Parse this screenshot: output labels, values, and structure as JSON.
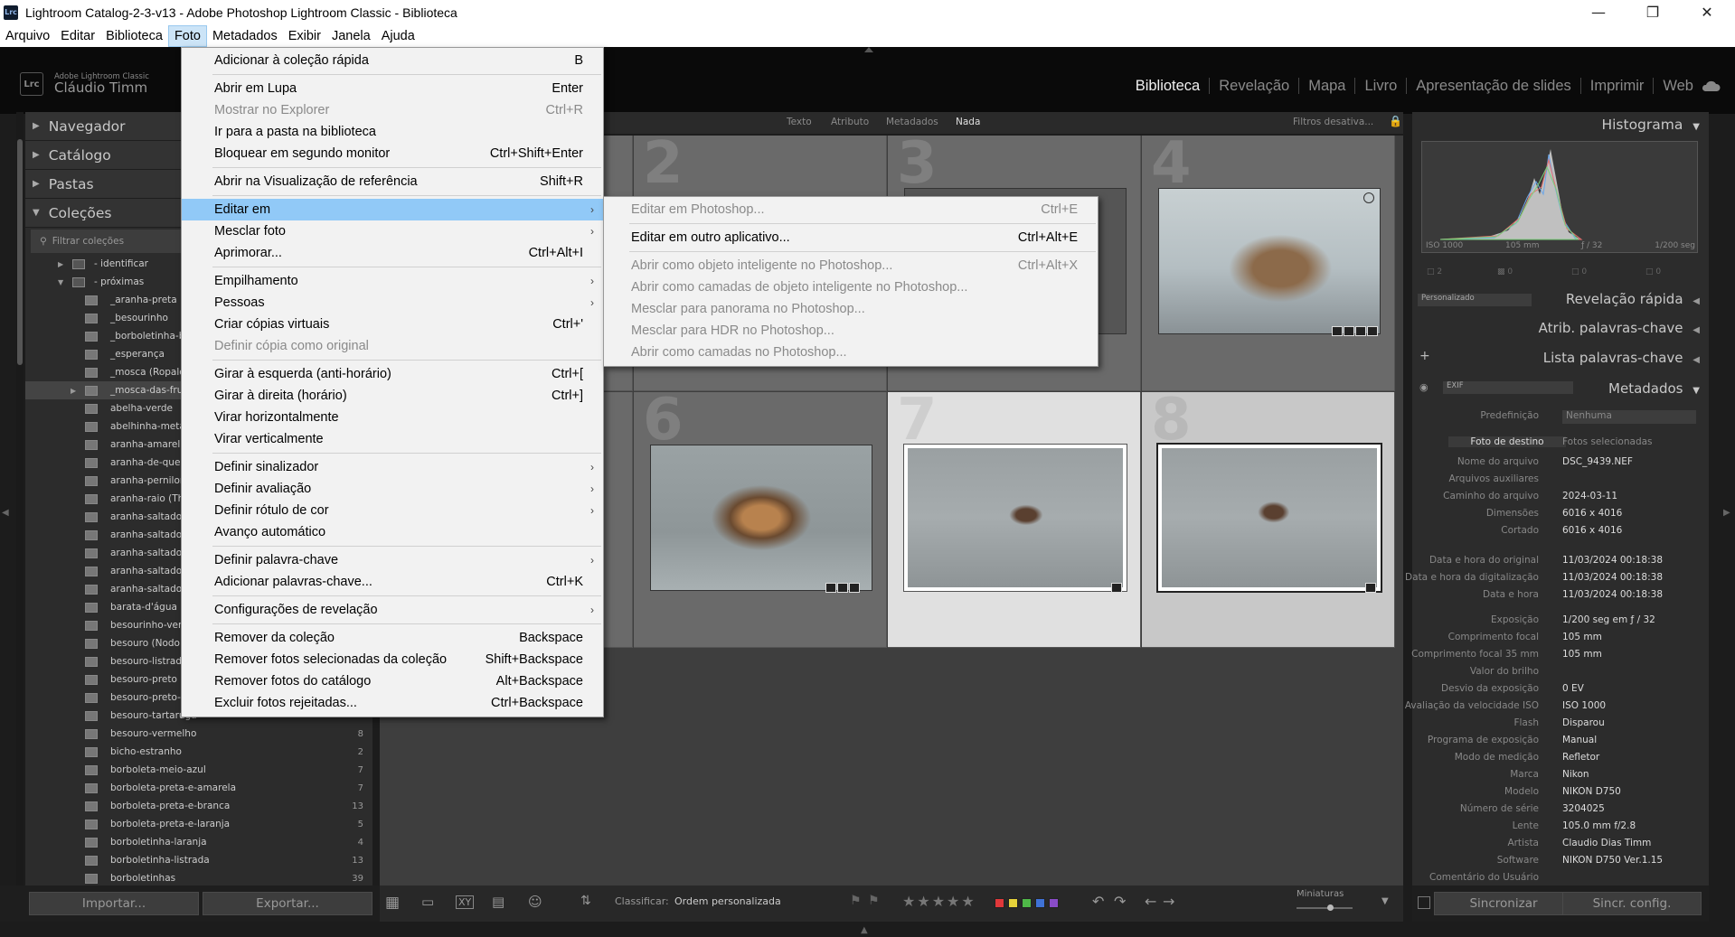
{
  "window": {
    "badge": "Lrc",
    "title": "Lightroom Catalog-2-3-v13 - Adobe Photoshop Lightroom Classic - Biblioteca"
  },
  "menubar": [
    "Arquivo",
    "Editar",
    "Biblioteca",
    "Foto",
    "Metadados",
    "Exibir",
    "Janela",
    "Ajuda"
  ],
  "identity": {
    "logo": "Lrc",
    "app": "Adobe Lightroom Classic",
    "user": "Cláudio Timm"
  },
  "modules": [
    "Biblioteca",
    "Revelação",
    "Mapa",
    "Livro",
    "Apresentação de slides",
    "Imprimir",
    "Web"
  ],
  "left": {
    "navigator": "Navegador",
    "catalog": "Catálogo",
    "folders": "Pastas",
    "collections": "Coleções",
    "filter_placeholder": "Filtrar coleções",
    "sets": [
      {
        "name": "- identificar",
        "state": "collapsed"
      },
      {
        "name": "- próximas",
        "state": "expanded"
      }
    ],
    "items": [
      {
        "name": "_aranha-preta (",
        "count": ""
      },
      {
        "name": "_besourinho",
        "count": ""
      },
      {
        "name": "_borboletinha-b",
        "count": ""
      },
      {
        "name": "_esperança",
        "count": ""
      },
      {
        "name": "_mosca (Ropalc",
        "count": ""
      },
      {
        "name": "_mosca-das-frut",
        "count": ""
      },
      {
        "name": "abelha-verde",
        "count": ""
      },
      {
        "name": "abelhinha-meta",
        "count": ""
      },
      {
        "name": "aranha-amarel",
        "count": ""
      },
      {
        "name": "aranha-de-quel",
        "count": ""
      },
      {
        "name": "aranha-pernilor",
        "count": ""
      },
      {
        "name": "aranha-raio (Th",
        "count": ""
      },
      {
        "name": "aranha-saltado",
        "count": ""
      },
      {
        "name": "aranha-saltado",
        "count": ""
      },
      {
        "name": "aranha-saltado",
        "count": ""
      },
      {
        "name": "aranha-saltado",
        "count": ""
      },
      {
        "name": "aranha-saltado",
        "count": ""
      },
      {
        "name": "barata-d'água",
        "count": ""
      },
      {
        "name": "besourinho-ver",
        "count": ""
      },
      {
        "name": "besouro (Nodo",
        "count": ""
      },
      {
        "name": "besouro-listrad",
        "count": ""
      },
      {
        "name": "besouro-preto",
        "count": ""
      },
      {
        "name": "besouro-preto-",
        "count": ""
      },
      {
        "name": "besouro-tartaruga",
        "count": ""
      },
      {
        "name": "besouro-vermelho",
        "count": "8"
      },
      {
        "name": "bicho-estranho",
        "count": "2"
      },
      {
        "name": "borboleta-meio-azul",
        "count": "7"
      },
      {
        "name": "borboleta-preta-e-amarela",
        "count": "7"
      },
      {
        "name": "borboleta-preta-e-branca",
        "count": "13"
      },
      {
        "name": "borboleta-preta-e-laranja",
        "count": "5"
      },
      {
        "name": "borboletinha-laranja",
        "count": "4"
      },
      {
        "name": "borboletinha-listrada",
        "count": "13"
      },
      {
        "name": "borboletinhas",
        "count": "39"
      }
    ],
    "import_label": "Importar...",
    "export_label": "Exportar..."
  },
  "filterbar": {
    "items": [
      "Texto",
      "Atributo",
      "Metadados",
      "Nada"
    ],
    "active": "Nada",
    "preset": "Filtros desativa..."
  },
  "grid": {
    "cells": [
      "",
      "2",
      "3",
      "4",
      "",
      "6",
      "7",
      "8"
    ]
  },
  "toolbar": {
    "sort_label": "Classificar:",
    "sort_value": "Ordem personalizada",
    "stars": "★★★★★",
    "thumbs_label": "Miniaturas",
    "colors": [
      "#e0383a",
      "#e6d23a",
      "#4fb848",
      "#3f72d6",
      "#8a4cc8"
    ]
  },
  "right": {
    "histogram": "Histograma",
    "hist_info": [
      "ISO 1000",
      "105 mm",
      "ƒ / 32",
      "1/200 seg"
    ],
    "hist_crop_count": "2",
    "hist_row2": [
      "0",
      "0",
      "0"
    ],
    "quick_develop": "Revelação rápida",
    "quick_preset": "Personalizado",
    "keywording": "Atrib. palavras-chave",
    "keyword_list": "Lista palavras-chave",
    "metadata": "Metadados",
    "meta_preset": "EXIF",
    "preset_label": "Predefinição",
    "preset_value": "Nenhuma",
    "target_photo": "Foto de destino",
    "selected_photos": "Fotos selecionadas",
    "fields": [
      {
        "label": "Nome do arquivo",
        "value": "DSC_9439.NEF"
      },
      {
        "label": "Arquivos auxiliares",
        "value": ""
      },
      {
        "label": "Caminho do arquivo",
        "value": "2024-03-11"
      },
      {
        "label": "Dimensões",
        "value": "6016 x 4016"
      },
      {
        "label": "Cortado",
        "value": "6016 x 4016"
      },
      {
        "label": "Data e hora do original",
        "value": "11/03/2024 00:18:38"
      },
      {
        "label": "Data e hora da digitalização",
        "value": "11/03/2024 00:18:38"
      },
      {
        "label": "Data e hora",
        "value": "11/03/2024 00:18:38"
      },
      {
        "label": "Exposição",
        "value": "1/200 seg em ƒ / 32"
      },
      {
        "label": "Comprimento focal",
        "value": "105 mm"
      },
      {
        "label": "Comprimento focal 35 mm",
        "value": "105 mm"
      },
      {
        "label": "Valor do brilho",
        "value": ""
      },
      {
        "label": "Desvio da exposição",
        "value": "0 EV"
      },
      {
        "label": "Avaliação da velocidade ISO",
        "value": "ISO 1000"
      },
      {
        "label": "Flash",
        "value": "Disparou"
      },
      {
        "label": "Programa de exposição",
        "value": "Manual"
      },
      {
        "label": "Modo de medição",
        "value": "Refletor"
      },
      {
        "label": "Marca",
        "value": "Nikon"
      },
      {
        "label": "Modelo",
        "value": "NIKON D750"
      },
      {
        "label": "Número de série",
        "value": "3204025"
      },
      {
        "label": "Lente",
        "value": "105.0 mm f/2.8"
      },
      {
        "label": "Artista",
        "value": "Claudio Dias Timm"
      },
      {
        "label": "Software",
        "value": "NIKON D750 Ver.1.15"
      },
      {
        "label": "Comentário do Usuário",
        "value": ""
      }
    ],
    "sync_label": "Sincronizar",
    "sync_settings_label": "Sincr. config."
  },
  "foto_menu": [
    {
      "label": "Adicionar à coleção rápida",
      "shortcut": "B"
    },
    {
      "sep": true
    },
    {
      "label": "Abrir em Lupa",
      "shortcut": "Enter"
    },
    {
      "label": "Mostrar no Explorer",
      "shortcut": "Ctrl+R",
      "disabled": true
    },
    {
      "label": "Ir para a pasta na biblioteca",
      "shortcut": ""
    },
    {
      "label": "Bloquear em segundo monitor",
      "shortcut": "Ctrl+Shift+Enter"
    },
    {
      "sep": true
    },
    {
      "label": "Abrir na Visualização de referência",
      "shortcut": "Shift+R"
    },
    {
      "sep": true
    },
    {
      "label": "Editar em",
      "submenu": true,
      "highlight": true
    },
    {
      "label": "Mesclar foto",
      "submenu": true
    },
    {
      "label": "Aprimorar...",
      "shortcut": "Ctrl+Alt+I"
    },
    {
      "sep": true
    },
    {
      "label": "Empilhamento",
      "submenu": true
    },
    {
      "label": "Pessoas",
      "submenu": true
    },
    {
      "label": "Criar cópias virtuais",
      "shortcut": "Ctrl+'"
    },
    {
      "label": "Definir cópia como original",
      "shortcut": "",
      "disabled": true
    },
    {
      "sep": true
    },
    {
      "label": "Girar à esquerda (anti-horário)",
      "shortcut": "Ctrl+["
    },
    {
      "label": "Girar à direita (horário)",
      "shortcut": "Ctrl+]"
    },
    {
      "label": "Virar horizontalmente",
      "shortcut": ""
    },
    {
      "label": "Virar verticalmente",
      "shortcut": ""
    },
    {
      "sep": true
    },
    {
      "label": "Definir sinalizador",
      "submenu": true
    },
    {
      "label": "Definir avaliação",
      "submenu": true
    },
    {
      "label": "Definir rótulo de cor",
      "submenu": true
    },
    {
      "label": "Avanço automático",
      "shortcut": ""
    },
    {
      "sep": true
    },
    {
      "label": "Definir palavra-chave",
      "submenu": true
    },
    {
      "label": "Adicionar palavras-chave...",
      "shortcut": "Ctrl+K"
    },
    {
      "sep": true
    },
    {
      "label": "Configurações de revelação",
      "submenu": true
    },
    {
      "sep": true
    },
    {
      "label": "Remover da coleção",
      "shortcut": "Backspace"
    },
    {
      "label": "Remover fotos selecionadas da coleção",
      "shortcut": "Shift+Backspace"
    },
    {
      "label": "Remover fotos do catálogo",
      "shortcut": "Alt+Backspace"
    },
    {
      "label": "Excluir fotos rejeitadas...",
      "shortcut": "Ctrl+Backspace"
    }
  ],
  "edit_in_menu": [
    {
      "label": "Editar em Photoshop...",
      "shortcut": "Ctrl+E",
      "disabled": true
    },
    {
      "sep": true
    },
    {
      "label": "Editar em outro aplicativo...",
      "shortcut": "Ctrl+Alt+E"
    },
    {
      "sep": true
    },
    {
      "label": "Abrir como objeto inteligente no Photoshop...",
      "shortcut": "Ctrl+Alt+X",
      "disabled": true
    },
    {
      "label": "Abrir como camadas de objeto inteligente no Photoshop...",
      "shortcut": "",
      "disabled": true
    },
    {
      "label": "Mesclar para panorama no Photoshop...",
      "shortcut": "",
      "disabled": true
    },
    {
      "label": "Mesclar para HDR no Photoshop...",
      "shortcut": "",
      "disabled": true
    },
    {
      "label": "Abrir como camadas no Photoshop...",
      "shortcut": "",
      "disabled": true
    }
  ]
}
